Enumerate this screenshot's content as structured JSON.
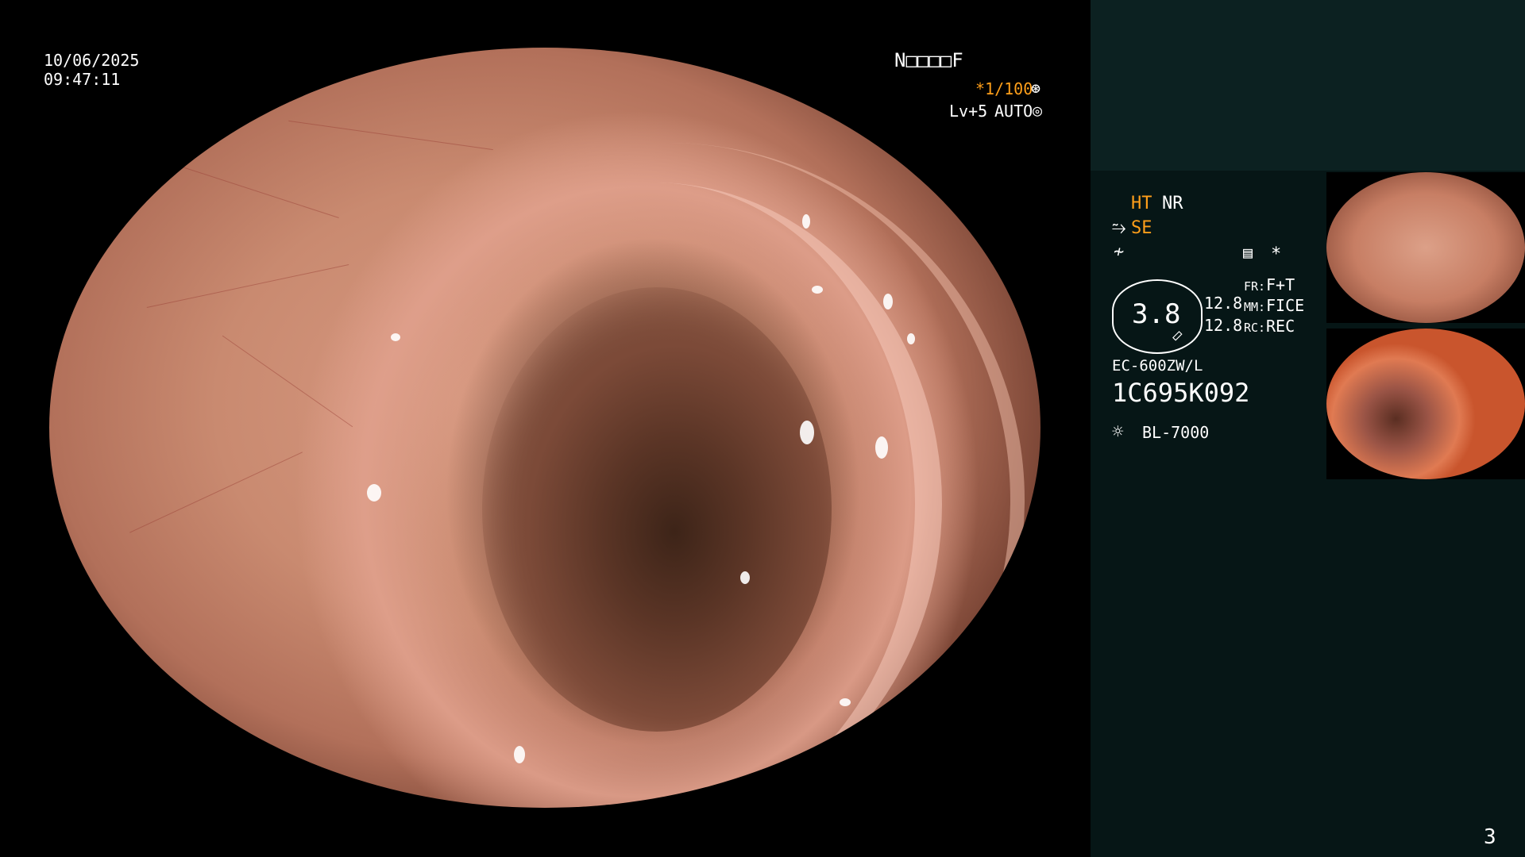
{
  "overlay": {
    "date": "10/06/2025",
    "time": "09:47:11",
    "patient_code": "N□□□□F",
    "shutter": "*1/100",
    "level": "Lv+5",
    "iris_mode": "AUTO"
  },
  "side_panel": {
    "ht": "HT",
    "nr": "NR",
    "se": "SE",
    "zoom": "3.8",
    "fr_label": "FR:",
    "fr_value": "F+T",
    "mm_label": "MM:",
    "mm_value": "FICE",
    "rc_label": "RC:",
    "rc_value": "REC",
    "val1": "12.8",
    "val2": "12.8",
    "scope_model": "EC-600ZW/L",
    "scope_serial": "1C695K092",
    "light_source": "BL-7000",
    "asterisk": "*"
  },
  "page_number": "3",
  "colors": {
    "accent_orange": "#ff9f1a",
    "panel_bg": "#061616",
    "panel_top": "#0c2121"
  },
  "icons": [
    "structure-enhance-icon",
    "fice-icon",
    "memory-icon",
    "iris-icon",
    "shutter-icon",
    "light-source-icon",
    "zoom-lens-icon"
  ]
}
